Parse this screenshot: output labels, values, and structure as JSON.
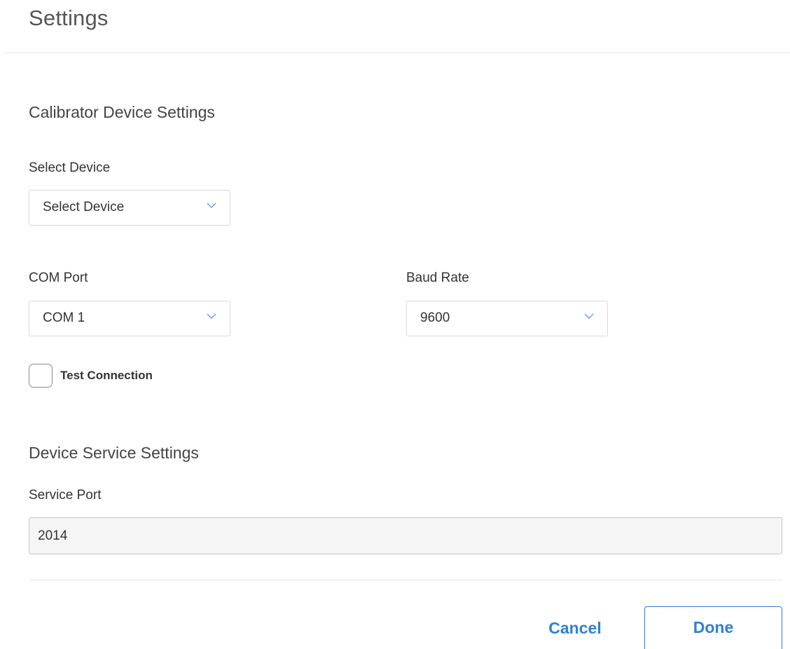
{
  "dialog": {
    "title": "Settings"
  },
  "calibrator": {
    "heading": "Calibrator Device Settings",
    "device": {
      "label": "Select Device",
      "value": "Select Device"
    },
    "com_port": {
      "label": "COM Port",
      "value": "COM 1"
    },
    "baud_rate": {
      "label": "Baud Rate",
      "value": "9600"
    },
    "test_connection": {
      "label": "Test Connection",
      "checked": false
    }
  },
  "service": {
    "heading": "Device Service Settings",
    "port": {
      "label": "Service Port",
      "value": "2014"
    }
  },
  "footer": {
    "cancel_label": "Cancel",
    "done_label": "Done"
  },
  "colors": {
    "accent": "#2f80d8",
    "chevron": "#6a9fe0"
  },
  "icons": {
    "dropdown": "chevron-down-icon"
  }
}
